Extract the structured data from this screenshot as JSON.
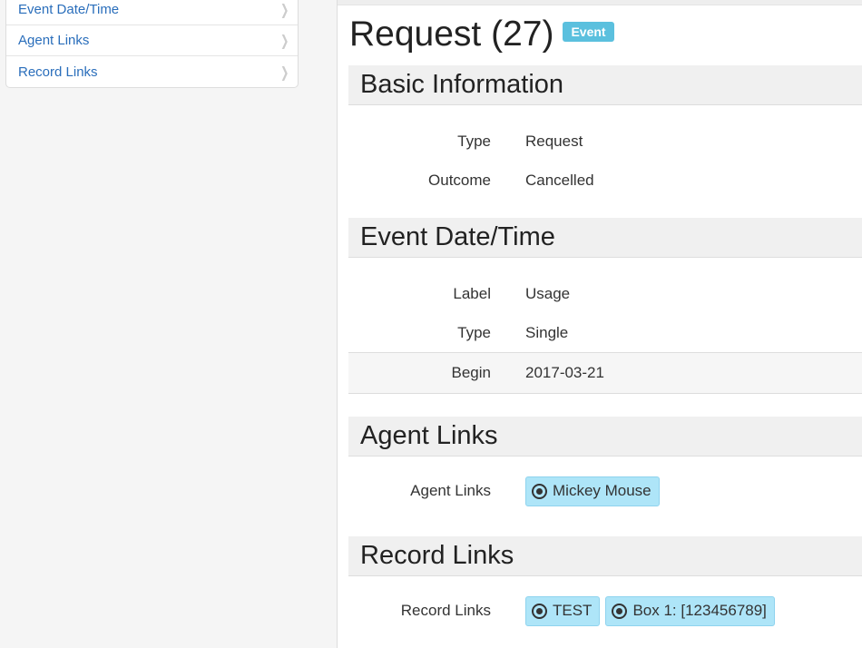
{
  "sidebar": {
    "items": [
      {
        "label": "Event Date/Time"
      },
      {
        "label": "Agent Links"
      },
      {
        "label": "Record Links"
      }
    ]
  },
  "header": {
    "title": "Request (27)",
    "badge": "Event"
  },
  "sections": {
    "basic": {
      "title": "Basic Information",
      "type_label": "Type",
      "type_value": "Request",
      "outcome_label": "Outcome",
      "outcome_value": "Cancelled"
    },
    "datetime": {
      "title": "Event Date/Time",
      "label_label": "Label",
      "label_value": "Usage",
      "type_label": "Type",
      "type_value": "Single",
      "begin_label": "Begin",
      "begin_value": "2017-03-21"
    },
    "agents": {
      "title": "Agent Links",
      "row_label": "Agent Links",
      "links": [
        "Mickey Mouse"
      ]
    },
    "records": {
      "title": "Record Links",
      "row_label": "Record Links",
      "links": [
        "TEST",
        "Box 1: [123456789]"
      ]
    }
  },
  "colors": {
    "link": "#2a6ebb",
    "badge": "#5bc0de",
    "token": "#aee5f8"
  }
}
